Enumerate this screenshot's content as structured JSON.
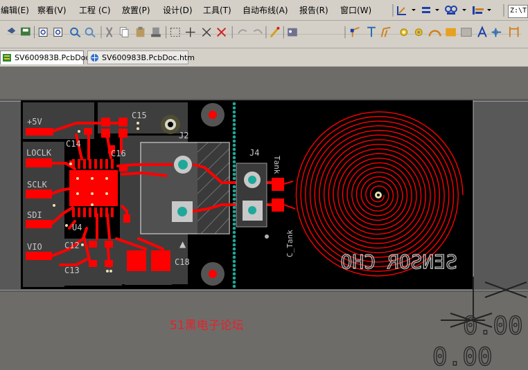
{
  "menu": {
    "items": [
      "编辑(E)",
      "察看(V)",
      "工程 (C)",
      "放置(P)",
      "设计(D)",
      "工具(T)",
      "自动布线(A)",
      "报告(R)",
      "窗口(W)"
    ]
  },
  "coord_field": {
    "value": "Z:\\T"
  },
  "tabs": [
    "SV600983B.PcbDoc",
    "SV600983B.PcbDoc.htm"
  ],
  "pcb": {
    "net_labels": [
      "+5V",
      "LOCLK",
      "SCLK",
      "SDI",
      "VIO"
    ],
    "ref_designators": [
      "C15",
      "C14",
      "C16",
      "J2",
      "J4",
      "U4",
      "C12",
      "C13",
      "C18"
    ],
    "coil_label_mirrored": "SENSOR CHO",
    "tank_label": "C_Tank",
    "j4_side_label": "Tank",
    "pin_marker": "▲",
    "forum_watermark": "51黑电子论坛",
    "dim_readout_top": "0.00",
    "dim_readout_bottom": "0.00"
  },
  "colors": {
    "copper_top": "#ff0000",
    "board_background": "#000000",
    "workspace": "#6e6c69",
    "via_cyan": "#1ea89a",
    "silkscreen": "#c8c8c8",
    "watermark_red": "#e8202a"
  }
}
